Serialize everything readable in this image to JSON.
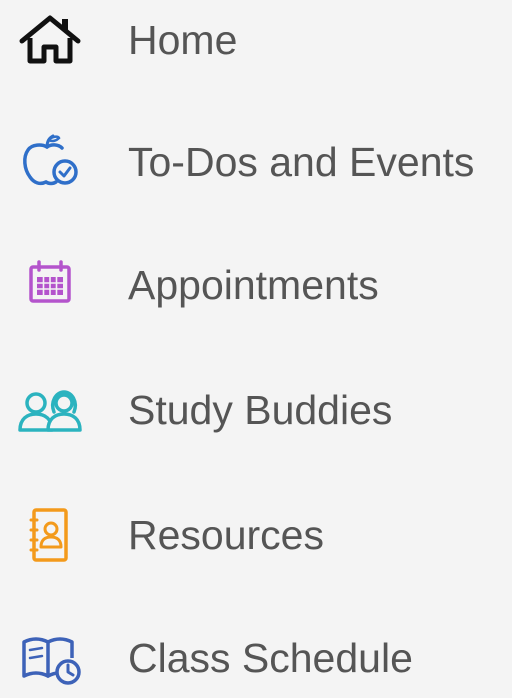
{
  "sidebar": {
    "items": [
      {
        "label": "Home",
        "icon": "home-icon",
        "color": "#111111"
      },
      {
        "label": "To-Dos and Events",
        "icon": "apple-check-icon",
        "color": "#2f6fc9"
      },
      {
        "label": "Appointments",
        "icon": "calendar-icon",
        "color": "#b454cc"
      },
      {
        "label": "Study Buddies",
        "icon": "people-icon",
        "color": "#2bb3bf"
      },
      {
        "label": "Resources",
        "icon": "contact-book-icon",
        "color": "#f39a1b"
      },
      {
        "label": "Class Schedule",
        "icon": "book-clock-icon",
        "color": "#3d62b8"
      }
    ]
  }
}
